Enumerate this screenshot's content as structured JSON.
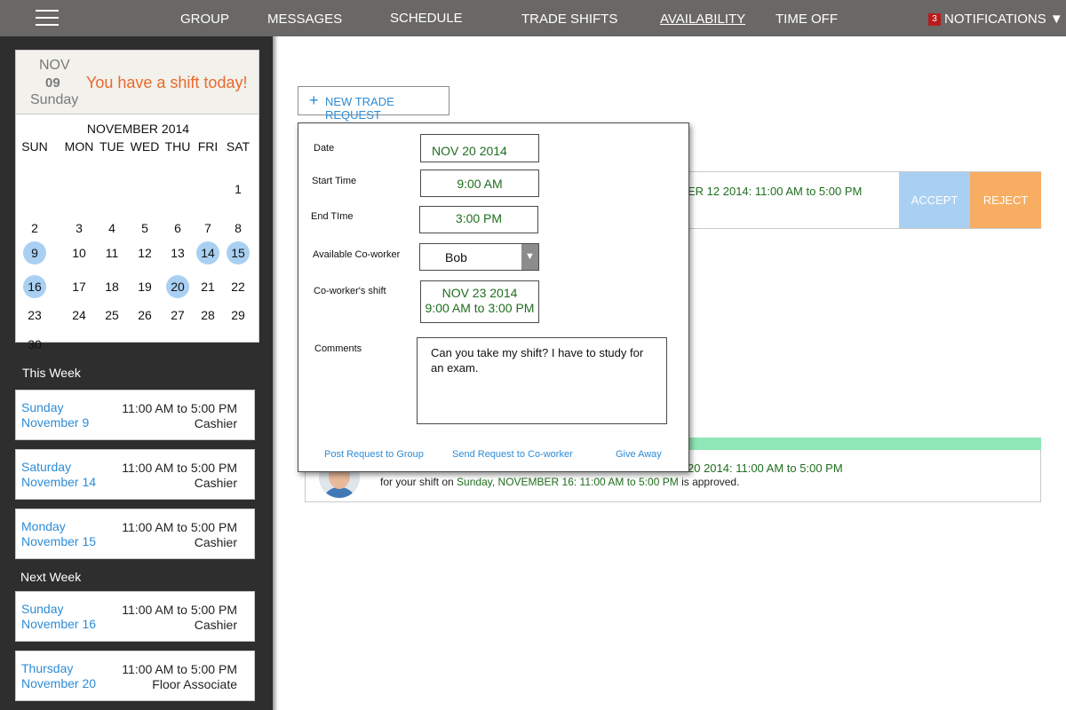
{
  "nav": {
    "items": [
      "GROUP",
      "MESSAGES",
      "SCHEDULE",
      "TRADE SHIFTS",
      "AVAILABILITY",
      "TIME OFF"
    ],
    "active": "AVAILABILITY",
    "notifications_count": "3",
    "notifications_label": "NOTIFICATIONS ▼"
  },
  "today": {
    "month": "NOV",
    "day": "09",
    "weekday": "Sunday",
    "message": "You have a shift today!"
  },
  "calendar": {
    "title": "NOVEMBER 2014",
    "weekdays": [
      "SUN",
      "MON",
      "TUE",
      "WED",
      "THU",
      "FRI",
      "SAT"
    ],
    "first_weekday_index": 6,
    "days_in_month": 30,
    "highlighted_days": [
      9,
      14,
      15,
      16,
      20
    ]
  },
  "this_week": {
    "label": "This Week",
    "shifts": [
      {
        "day": "Sunday",
        "date": "November 9",
        "time": "11:00 AM to 5:00 PM",
        "role": "Cashier"
      },
      {
        "day": "Saturday",
        "date": "November 14",
        "time": "11:00 AM to 5:00 PM",
        "role": "Cashier"
      },
      {
        "day": "Monday",
        "date": "November 15",
        "time": "11:00 AM to 5:00 PM",
        "role": "Cashier"
      }
    ]
  },
  "next_week": {
    "label": "Next Week",
    "shifts": [
      {
        "day": "Sunday",
        "date": "November 16",
        "time": "11:00 AM to 5:00 PM",
        "role": "Cashier"
      },
      {
        "day": "Thursday",
        "date": "November 20",
        "time": "11:00 AM to 5:00 PM",
        "role": "Floor Associate"
      }
    ]
  },
  "main": {
    "new_trade_label": "NEW TRADE REQUEST",
    "request_text": "ER 12 2014: 11:00 AM to 5:00 PM",
    "accept_label": "ACCEPT",
    "reject_label": "REJECT",
    "approved_line1": "20 2014: 11:00 AM to 5:00 PM",
    "approved_pre": "for your shift on ",
    "approved_date": "Sunday, NOVEMBER 16: 11:00 AM to 5:00 PM",
    "approved_post": " is approved."
  },
  "dialog": {
    "date_label": "Date",
    "date_value": "NOV 20 2014",
    "start_label": "Start Time",
    "start_value": "9:00 AM",
    "end_label": "End TIme",
    "end_value": "3:00 PM",
    "coworker_label": "Available Co-worker",
    "coworker_value": "Bob",
    "coworker_shift_label": "Co-worker's shift",
    "coworker_shift_date": "NOV 23 2014",
    "coworker_shift_time": "9:00 AM to 3:00 PM",
    "comments_label": "Comments",
    "comments_value": "Can you take my shift? I have to study for an exam.",
    "post_group_label": "Post Request to Group",
    "send_coworker_label": "Send Request to Co-worker",
    "give_away_label": "Give Away"
  },
  "colors": {
    "topbar": "#6a6866",
    "sidebar": "#2e2e2e",
    "accent_blue": "#2d8cd6",
    "accent_orange": "#e8692c",
    "green_text": "#1e6e1e",
    "accept": "#a9d0f2",
    "reject": "#f7ad62",
    "approved": "#8fe6b6"
  }
}
